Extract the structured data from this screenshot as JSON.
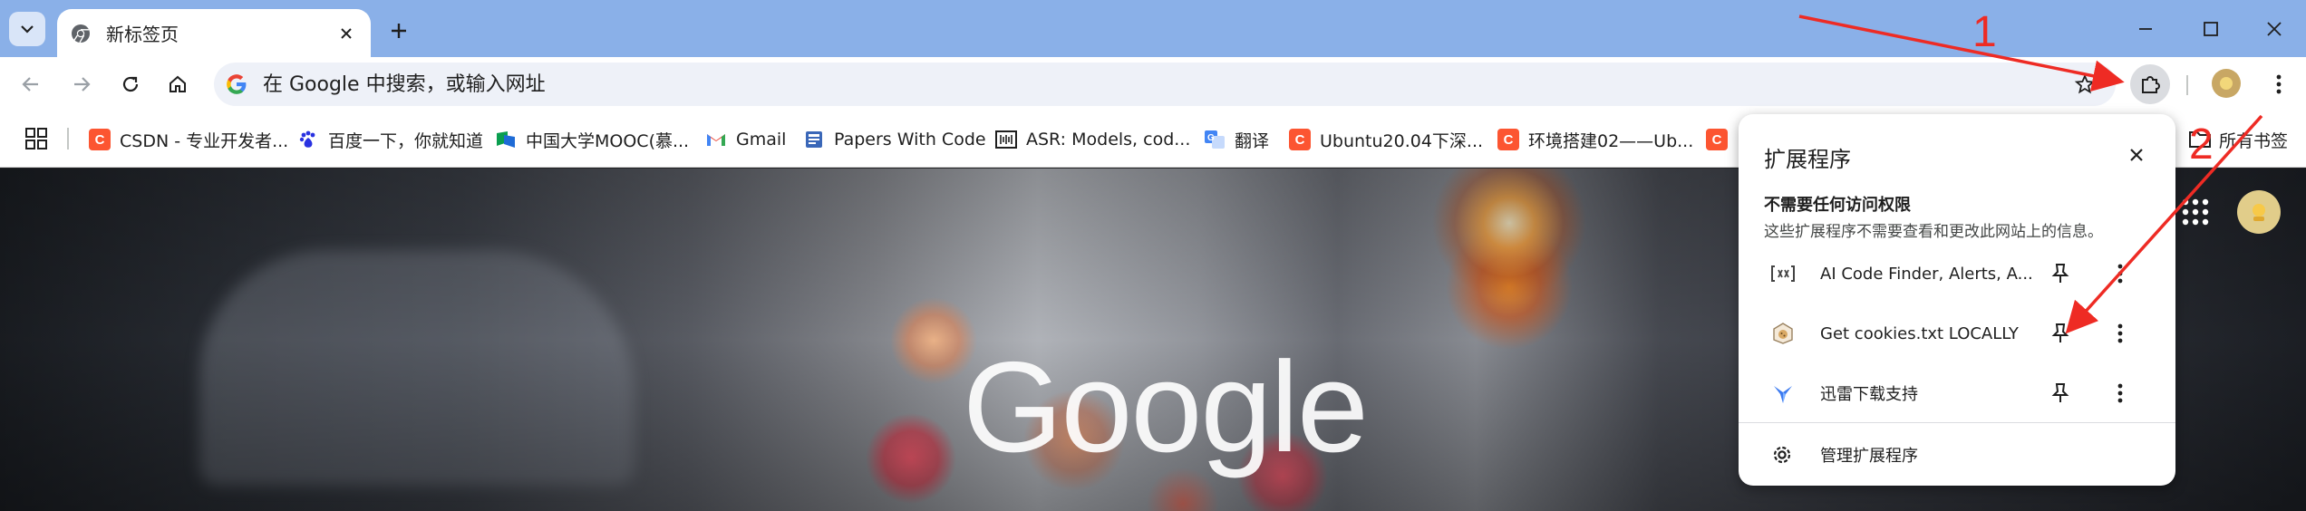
{
  "tab": {
    "title": "新标签页"
  },
  "omnibox": {
    "placeholder": "在 Google 中搜索，或输入网址"
  },
  "bookmarks": [
    {
      "label": "CSDN - 专业开发者...",
      "icon": "csdn-icon",
      "color": "#fc5531"
    },
    {
      "label": "百度一下，你就知道",
      "icon": "baidu-icon",
      "color": "#2932e1"
    },
    {
      "label": "中国大学MOOC(慕...",
      "icon": "mooc-icon",
      "color": "#0a9e4f"
    },
    {
      "label": "Gmail",
      "icon": "gmail-icon",
      "color": "#ea4335"
    },
    {
      "label": "Papers With Code",
      "icon": "paperswithcode-icon",
      "color": "#21cbce"
    },
    {
      "label": "ASR: Models, cod...",
      "icon": "pwc-bracket-icon",
      "color": "#1f1f1f"
    },
    {
      "label": "翻译",
      "icon": "translate-icon",
      "color": "#4285f4"
    },
    {
      "label": "Ubuntu20.04下深...",
      "icon": "csdn-icon",
      "color": "#fc5531"
    },
    {
      "label": "环境搭建02——Ub...",
      "icon": "csdn-icon",
      "color": "#fc5531"
    }
  ],
  "all_bookmarks_label": "所有书签",
  "page": {
    "logo_text": "Google"
  },
  "extensions_popup": {
    "title": "扩展程序",
    "section_title": "不需要任何访问权限",
    "section_desc": "这些扩展程序不需要查看和更改此网站上的信息。",
    "items": [
      {
        "name": "AI Code Finder, Alerts, A...",
        "icon": "code-finder-icon"
      },
      {
        "name": "Get cookies.txt LOCALLY",
        "icon": "cookie-icon"
      },
      {
        "name": "迅雷下载支持",
        "icon": "xunlei-icon"
      }
    ],
    "manage_label": "管理扩展程序"
  },
  "annotations": {
    "label_1": "1",
    "label_2": "2",
    "color": "#ee2b24"
  }
}
